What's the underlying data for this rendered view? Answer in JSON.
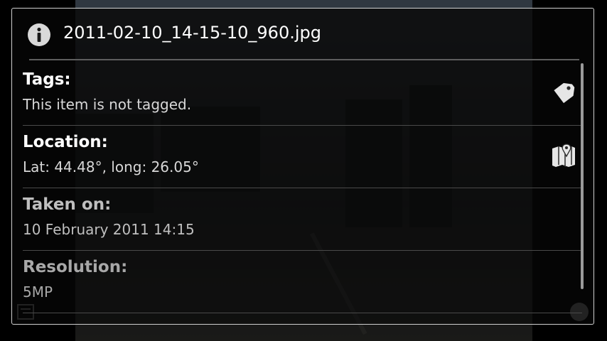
{
  "dialog": {
    "title": "2011-02-10_14-15-10_960.jpg",
    "header_icon": "info-icon"
  },
  "details": [
    {
      "label": "Tags:",
      "value": "This item is not tagged.",
      "action_icon": "tag-icon"
    },
    {
      "label": "Location:",
      "value": "Lat: 44.48°, long: 26.05°",
      "action_icon": "map-icon"
    },
    {
      "label": "Taken on:",
      "value": "10 February 2011 14:15"
    },
    {
      "label": "Resolution:",
      "value": "5MP"
    }
  ],
  "colors": {
    "dialog_border": "#cfcfcf",
    "text_primary": "#ffffff",
    "divider": "#4a4a4a"
  }
}
